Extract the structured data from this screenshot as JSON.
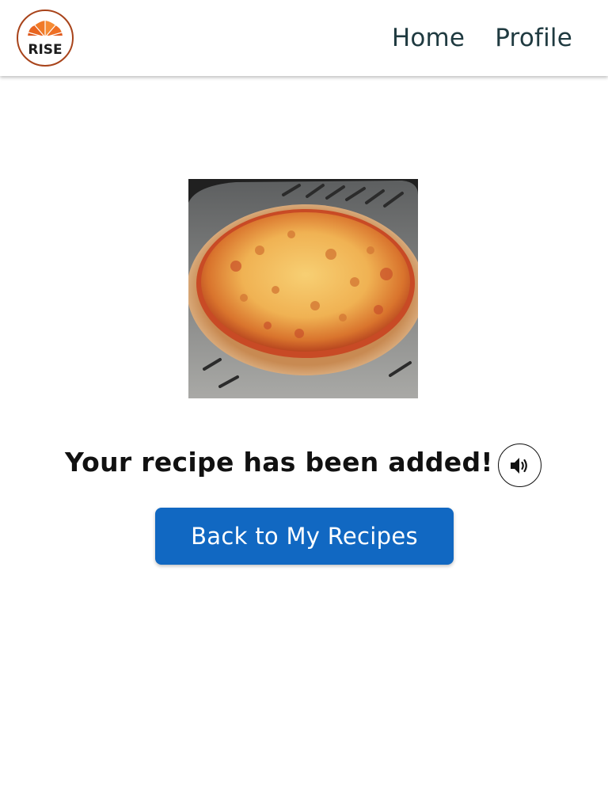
{
  "header": {
    "logo_text": "RISE",
    "nav": [
      {
        "label": "Home"
      },
      {
        "label": "Profile"
      }
    ]
  },
  "main": {
    "image_alt": "pizza-photo",
    "message": "Your recipe has been added!",
    "speaker_icon": "speaker-volume-icon",
    "back_button_label": "Back to My Recipes"
  },
  "colors": {
    "brand_orange": "#e8661e",
    "nav_text": "#1f3a40",
    "primary_button": "#1168c2"
  }
}
